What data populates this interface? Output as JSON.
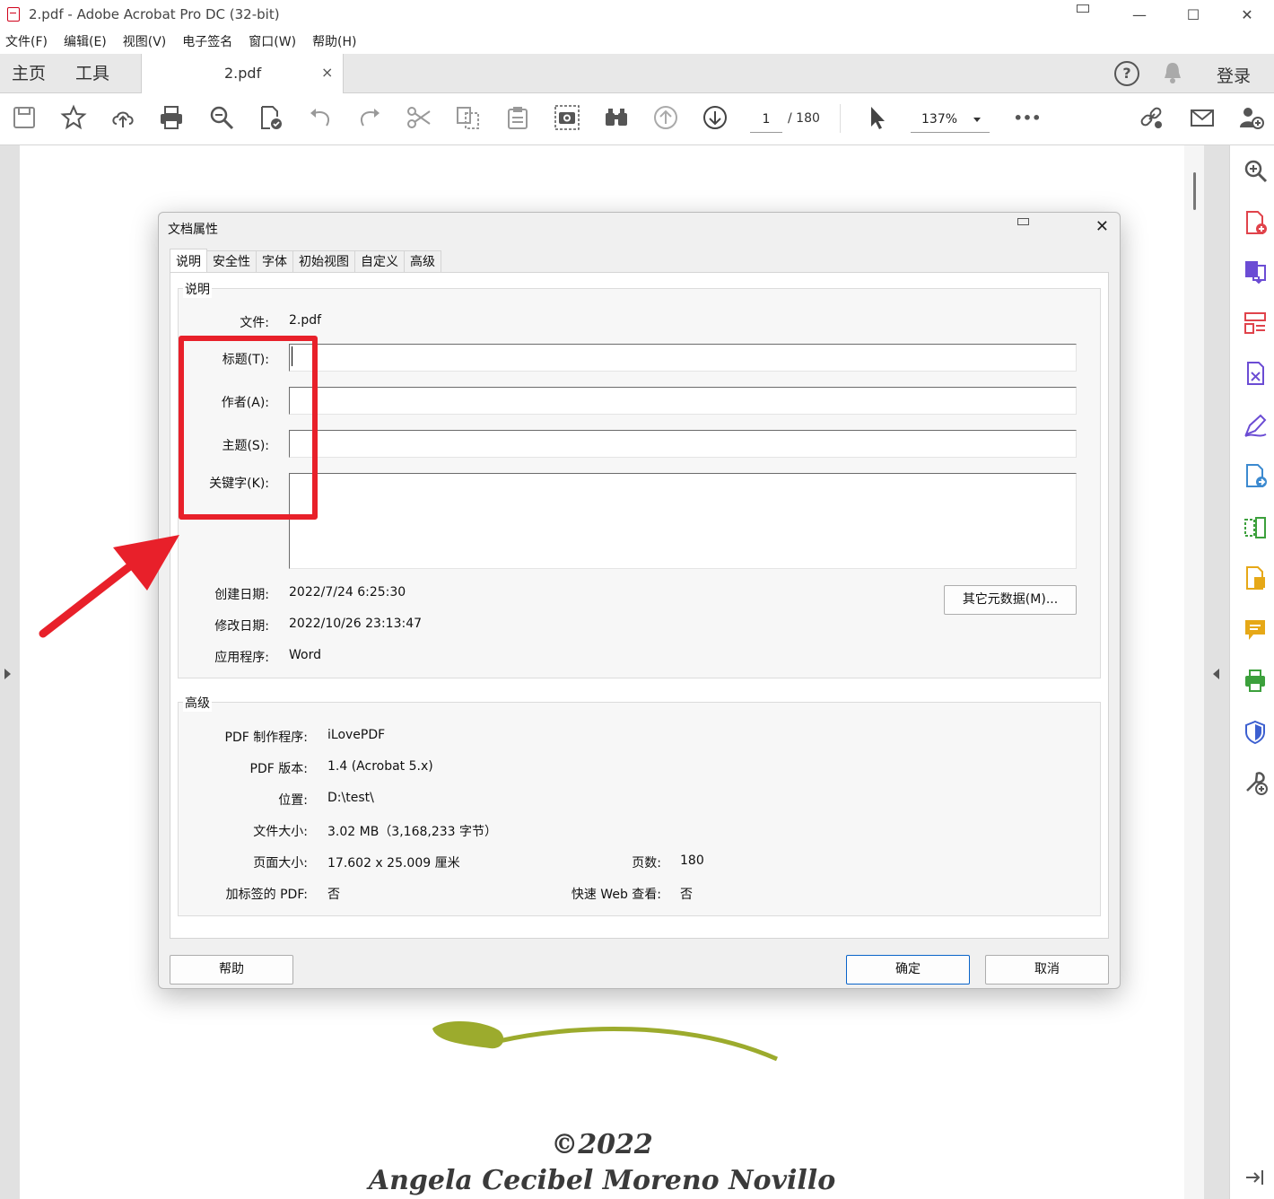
{
  "window": {
    "title": "2.pdf - Adobe Acrobat Pro DC (32-bit)",
    "controls": {
      "minimize": "—",
      "maximize": "☐",
      "close": "✕"
    }
  },
  "menu": [
    "文件(F)",
    "编辑(E)",
    "视图(V)",
    "电子签名",
    "窗口(W)",
    "帮助(H)"
  ],
  "tabs": {
    "home": "主页",
    "tools": "工具",
    "document": "2.pdf",
    "close": "×",
    "help": "?",
    "login": "登录"
  },
  "toolbar": {
    "page_current": "1",
    "page_total": "/ 180",
    "zoom": "137%",
    "more": "•••"
  },
  "page_content": {
    "copyright": "©2022",
    "author": "Angela Cecibel Moreno Novillo"
  },
  "dialog": {
    "title": "文档属性",
    "close": "✕",
    "tabs": [
      "说明",
      "安全性",
      "字体",
      "初始视图",
      "自定义",
      "高级"
    ],
    "description": {
      "section_title": "说明",
      "file_label": "文件:",
      "file_value": "2.pdf",
      "title_label": "标题(T):",
      "title_value": "",
      "author_label": "作者(A):",
      "author_value": "",
      "subject_label": "主题(S):",
      "subject_value": "",
      "keywords_label": "关键字(K):",
      "keywords_value": "",
      "created_label": "创建日期:",
      "created_value": "2022/7/24 6:25:30",
      "modified_label": "修改日期:",
      "modified_value": "2022/10/26 23:13:47",
      "app_label": "应用程序:",
      "app_value": "Word",
      "more_metadata_button": "其它元数据(M)..."
    },
    "advanced": {
      "section_title": "高级",
      "producer_label": "PDF 制作程序:",
      "producer_value": "iLovePDF",
      "version_label": "PDF 版本:",
      "version_value": "1.4 (Acrobat 5.x)",
      "location_label": "位置:",
      "location_value": "D:\\test\\",
      "filesize_label": "文件大小:",
      "filesize_value": "3.02 MB（3,168,233 字节）",
      "pagesize_label": "页面大小:",
      "pagesize_value": "17.602 x 25.009 厘米",
      "pages_label": "页数:",
      "pages_value": "180",
      "tagged_label": "加标签的 PDF:",
      "tagged_value": "否",
      "fastweb_label": "快速 Web 查看:",
      "fastweb_value": "否"
    },
    "buttons": {
      "help": "帮助",
      "ok": "确定",
      "cancel": "取消"
    }
  },
  "colors": {
    "annotation": "#e8202a",
    "accent": "#0a64c9",
    "tool_purple": "#6b4cd4",
    "tool_red": "#e0434b",
    "tool_yellow": "#e6a817",
    "tool_green": "#3ca03c"
  }
}
